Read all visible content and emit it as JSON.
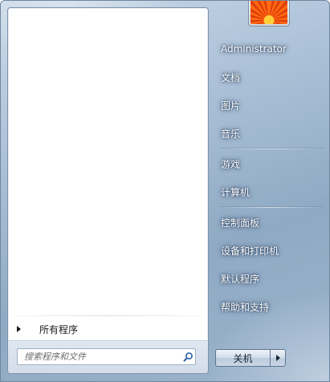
{
  "left_pane": {
    "all_programs_label": "所有程序",
    "search": {
      "placeholder": "搜索程序和文件",
      "value": ""
    }
  },
  "right_pane": {
    "user_picture": "user-avatar-flower",
    "items": [
      {
        "label": "Administrator"
      },
      {
        "label": "文档"
      },
      {
        "label": "图片"
      },
      {
        "label": "音乐"
      },
      {
        "label": "游戏"
      },
      {
        "label": "计算机"
      },
      {
        "label": "控制面板"
      },
      {
        "label": "设备和打印机"
      },
      {
        "label": "默认程序"
      },
      {
        "label": "帮助和支持"
      }
    ],
    "shutdown_label": "关机"
  },
  "colors": {
    "accent_blue": "#1f6fc5",
    "menu_text": "#ffffff",
    "left_text": "#1a1a1a"
  }
}
